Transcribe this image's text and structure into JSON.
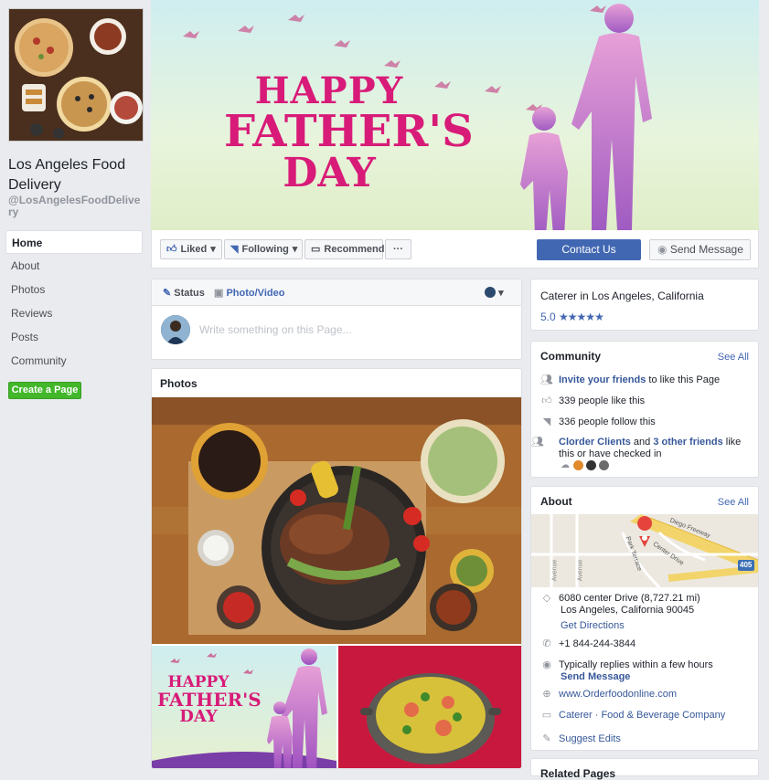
{
  "page": {
    "name": "Los Angeles Food Delivery",
    "handle": "@LosAngelesFoodDelivery"
  },
  "nav": [
    {
      "label": "Home"
    },
    {
      "label": "About"
    },
    {
      "label": "Photos"
    },
    {
      "label": "Reviews"
    },
    {
      "label": "Posts"
    },
    {
      "label": "Community"
    }
  ],
  "create_page_label": "Create a Page",
  "cover": {
    "line1": "HAPPY",
    "line2": "FATHER'S",
    "line3": "DAY"
  },
  "actions": {
    "liked": "Liked",
    "following": "Following",
    "recommend": "Recommend",
    "more": "···",
    "contact": "Contact Us",
    "send_message": "Send Message"
  },
  "composer": {
    "status_tab": "Status",
    "photo_tab": "Photo/Video",
    "placeholder": "Write something on this Page..."
  },
  "photos": {
    "title": "Photos",
    "thumb_text": [
      "HAPPY",
      "FATHER'S",
      "DAY"
    ]
  },
  "info": {
    "category": "Caterer in Los Angeles, California",
    "rating": "5.0",
    "stars": "★★★★★"
  },
  "community": {
    "title": "Community",
    "see_all": "See All",
    "invite_link": "Invite your friends",
    "invite_rest": " to like this Page",
    "likes": "339 people like this",
    "follows": "336 people follow this",
    "friends_link1": "Clorder Clients",
    "friends_and": " and ",
    "friends_link2": "3 other friends",
    "friends_rest": " like this or have checked in"
  },
  "about": {
    "title": "About",
    "see_all": "See All",
    "map_labels": [
      "Diego Freeway",
      "Center Drive",
      "Park Terrace",
      "Avenue",
      "Avenue",
      "405"
    ],
    "address_line1": "6080 center Drive (8,727.21 mi)",
    "address_line2": "Los Angeles, California 90045",
    "directions": "Get Directions",
    "phone": "+1 844-244-3844",
    "replies": "Typically replies within a few hours",
    "send_message": "Send Message",
    "website": "www.Orderfoodonline.com",
    "category": "Caterer · Food & Beverage Company",
    "suggest": "Suggest Edits"
  },
  "related": {
    "title": "Related Pages"
  },
  "colors": {
    "brand": "#4267b2",
    "green": "#42b72a",
    "pink": "#d81b78"
  }
}
